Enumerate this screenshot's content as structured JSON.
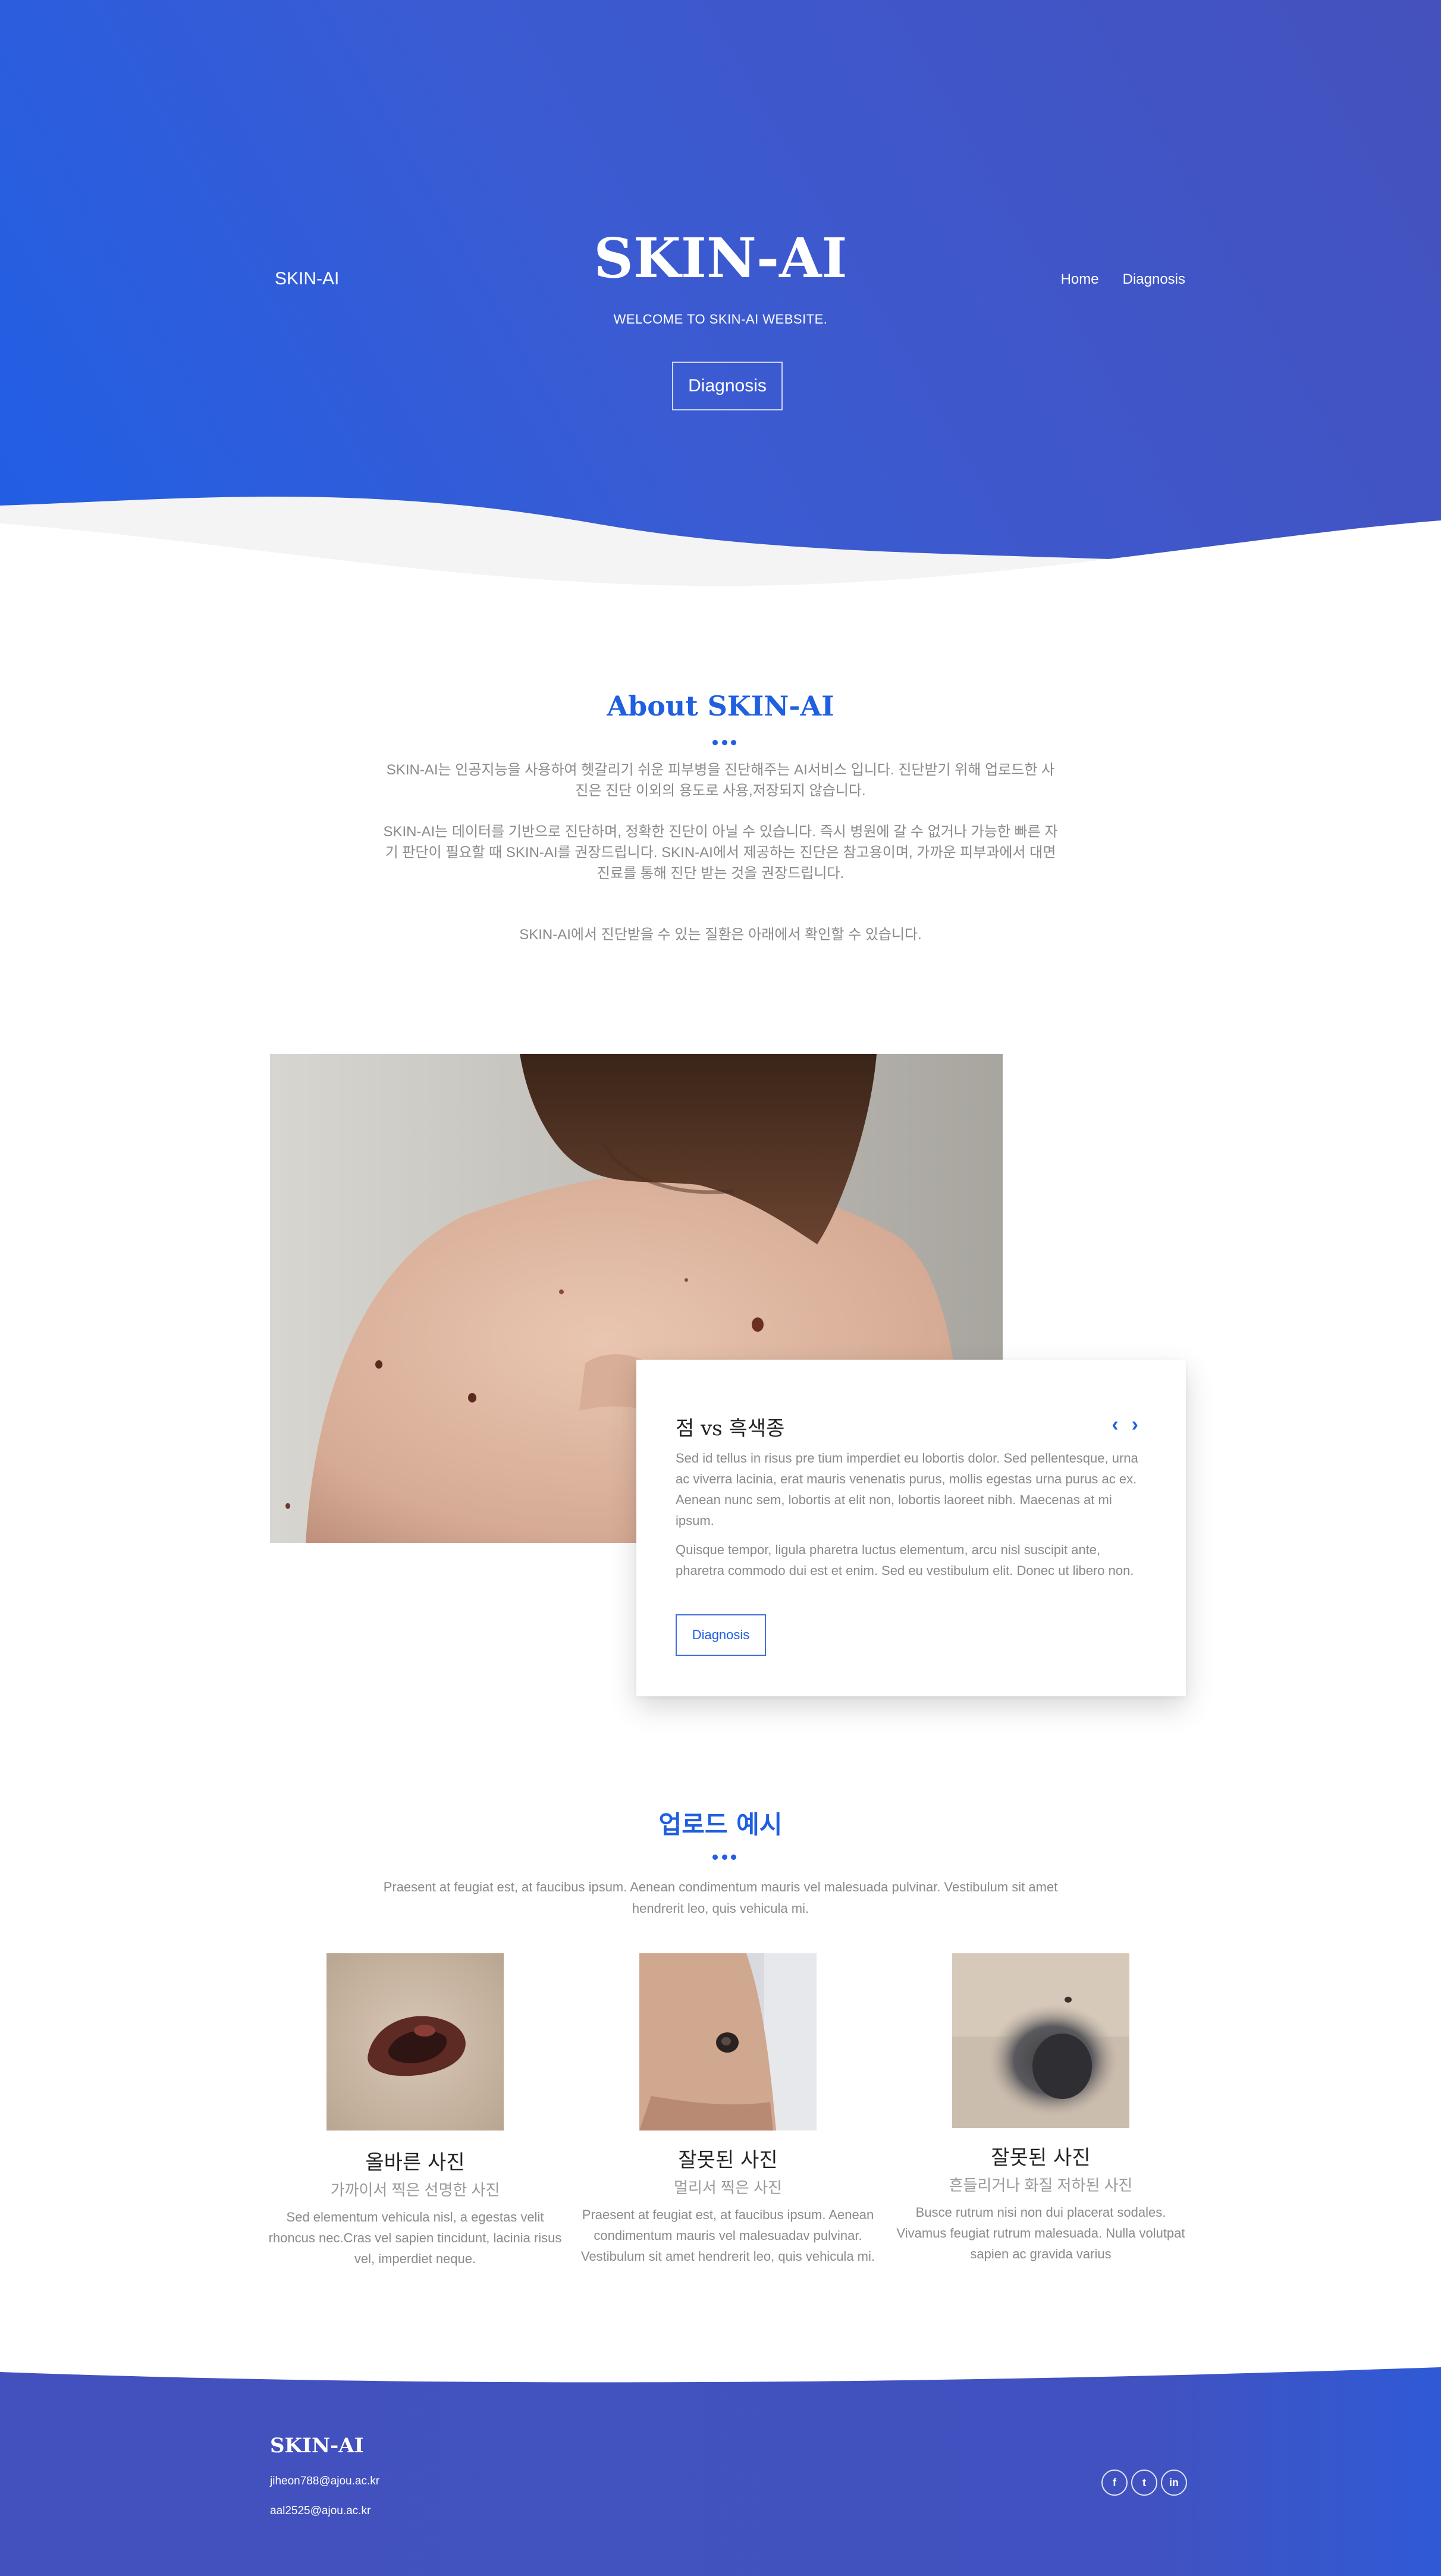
{
  "header": {
    "brand": "SKIN-AI",
    "nav": [
      {
        "label": "Home"
      },
      {
        "label": "Diagnosis"
      }
    ],
    "title": "SKIN-AI",
    "subtitle": "WELCOME TO SKIN-AI WEBSITE.",
    "cta_label": "Diagnosis"
  },
  "about": {
    "title": "About SKIN-AI",
    "paragraphs": [
      "SKIN-AI는 인공지능을 사용하여 헷갈리기 쉬운 피부병을 진단해주는 AI서비스 입니다. 진단받기 위해 업로드한 사진은 진단 이외의 용도로 사용,저장되지 않습니다.",
      "SKIN-AI는 데이터를 기반으로 진단하며, 정확한 진단이 아닐 수 있습니다. 즉시 병원에 갈 수 없거나 가능한 빠른 자기 판단이 필요할 때 SKIN-AI를 권장드립니다. SKIN-AI에서 제공하는 진단은 참고용이며, 가까운 피부과에서 대면 진료를 통해 진단 받는 것을 권장드립니다.",
      "SKIN-AI에서 진단받을 수 있는 질환은 아래에서 확인할 수 있습니다."
    ]
  },
  "feature": {
    "title": "점 vs 흑색종",
    "prev_icon": "chevron-left-icon",
    "next_icon": "chevron-right-icon",
    "paragraphs": [
      "Sed id tellus in risus pre tium imperdiet eu lobortis dolor. Sed pellentesque, urna ac viverra lacinia, erat mauris venenatis purus, mollis egestas urna purus ac ex. Aenean nunc sem, lobortis at elit non, lobortis laoreet nibh. Maecenas at mi ipsum.",
      "Quisque tempor, ligula pharetra luctus elementum, arcu nisl suscipit ante, pharetra commodo dui est et enim. Sed eu vestibulum elit. Donec ut libero non."
    ],
    "button_label": "Diagnosis"
  },
  "examples": {
    "title": "업로드 예시",
    "intro": "Praesent at feugiat est, at faucibus ipsum. Aenean condimentum mauris vel malesuada pulvinar. Vestibulum sit amet hendrerit leo, quis vehicula mi.",
    "items": [
      {
        "title": "올바른 사진",
        "subtitle": "가까이서 찍은 선명한 사진",
        "text": "Sed elementum vehicula nisl, a egestas velit rhoncus nec.Cras vel sapien tincidunt, lacinia risus vel, imperdiet neque."
      },
      {
        "title": "잘못된 사진",
        "subtitle": "멀리서 찍은 사진",
        "text": "Praesent at feugiat est, at faucibus ipsum. Aenean condimentum mauris vel malesuadav pulvinar. Vestibulum sit amet hendrerit leo, quis vehicula mi."
      },
      {
        "title": "잘못된 사진",
        "subtitle": "흔들리거나 화질 저하된 사진",
        "text": "Busce rutrum nisi non dui placerat sodales. Vivamus feugiat rutrum malesuada. Nulla volutpat sapien ac gravida varius"
      }
    ]
  },
  "footer": {
    "brand": "SKIN-AI",
    "emails": [
      "jiheon788@ajou.ac.kr",
      "aal2525@ajou.ac.kr"
    ],
    "socials": [
      {
        "icon": "facebook-icon",
        "glyph": "f"
      },
      {
        "icon": "twitter-icon",
        "glyph": "t"
      },
      {
        "icon": "linkedin-icon",
        "glyph": "in"
      }
    ]
  },
  "colors": {
    "accent": "#1f5fe0",
    "hero_start": "#1f5fe6",
    "hero_end": "#4551bd",
    "text_muted": "#8a8a8a"
  }
}
